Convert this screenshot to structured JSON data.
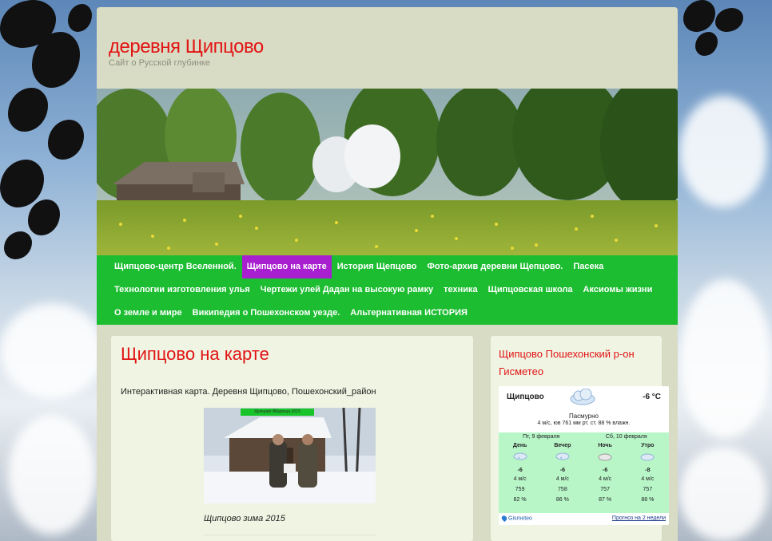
{
  "site": {
    "title": "деревня Щипцово",
    "tagline": "Сайт о Русской глубинке"
  },
  "nav": {
    "rows": [
      [
        {
          "label": "Щипцово-центр Вселенной.",
          "active": false
        },
        {
          "label": "Щипцово на карте",
          "active": true
        },
        {
          "label": "История Щепцово",
          "active": false
        },
        {
          "label": "Фото-архив деревни Щепцово.",
          "active": false
        },
        {
          "label": "Пасека",
          "active": false
        }
      ],
      [
        {
          "label": "Технологии изготовления улья",
          "active": false
        },
        {
          "label": "Чертежи улей Дадан на высокую рамку",
          "active": false
        },
        {
          "label": "техника",
          "active": false
        },
        {
          "label": "Щипцовская школа",
          "active": false
        },
        {
          "label": "Аксиомы жизни",
          "active": false
        }
      ],
      [
        {
          "label": "О земле и мире",
          "active": false
        },
        {
          "label": "Википедия о Пошехонском уезде.",
          "active": false
        },
        {
          "label": "Альтернативная ИСТОРИЯ",
          "active": false
        }
      ]
    ]
  },
  "post": {
    "title": "Щипцово на карте",
    "text": "Интерактивная карта. Деревня Щипцово, Пошехонский_район",
    "photo_label": "Щипцово Ябарзица 2015",
    "photo_caption": "Щипцово зима 2015"
  },
  "sidebar": {
    "widget_title": "Щипцово Пошехонский р-он Гисметео",
    "weather": {
      "city": "Щипцово",
      "temp_now": "-6 °C",
      "condition": "Пасмурно",
      "details": "4 м/с, юв  761 мм рт. ст.  88 % влажн.",
      "dates": [
        "Пт, 9 февраля",
        "Сб, 10 февраля"
      ],
      "periods": [
        {
          "label": "День",
          "temp": "-6",
          "wind": "4 м/с",
          "pressure": "759",
          "humidity": "82 %"
        },
        {
          "label": "Вечер",
          "temp": "-6",
          "wind": "4 м/с",
          "pressure": "758",
          "humidity": "86 %"
        },
        {
          "label": "Ночь",
          "temp": "-6",
          "wind": "4 м/с",
          "pressure": "757",
          "humidity": "87 %"
        },
        {
          "label": "Утро",
          "temp": "-8",
          "wind": "4 м/с",
          "pressure": "757",
          "humidity": "88 %"
        }
      ],
      "brand": "Gismeteo",
      "forecast_link": "Прогноз на 2 недели"
    }
  },
  "colors": {
    "title_red": "#e21414",
    "nav_green": "#1dbd32",
    "nav_active_purple": "#a81fcf",
    "page_bg": "#d9dcc4",
    "card_bg": "#eff4e3",
    "weather_grid": "#b8f6c8"
  }
}
